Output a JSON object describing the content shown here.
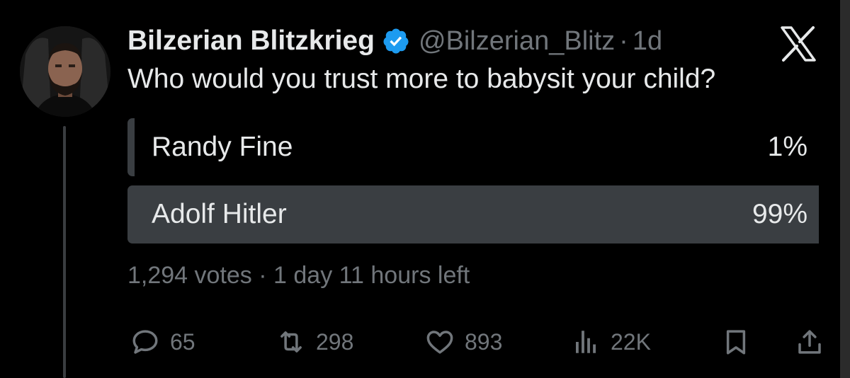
{
  "tweet": {
    "author_name": "Bilzerian Blitzkrieg",
    "handle": "@Bilzerian_Blitz",
    "separator": "·",
    "time_ago": "1d",
    "text": "Who would you trust more to babysit your child?"
  },
  "poll": {
    "options": [
      {
        "label": "Randy Fine",
        "percent": "1%",
        "share": 0.01
      },
      {
        "label": "Adolf Hitler",
        "percent": "99%",
        "share": 0.99
      }
    ],
    "votes": "1,294 votes",
    "separator": "·",
    "time_left": "1 day 11 hours left"
  },
  "actions": {
    "replies": "65",
    "reposts": "298",
    "likes": "893",
    "views": "22K"
  },
  "icons": {
    "verified": "verified-badge-icon",
    "logo": "x-logo-icon",
    "reply": "reply-icon",
    "repost": "repost-icon",
    "like": "heart-icon",
    "views": "views-icon",
    "bookmark": "bookmark-icon",
    "share": "share-icon"
  },
  "colors": {
    "background": "#000000",
    "text": "#e7e9ea",
    "secondary": "#71767b",
    "verified": "#1d9bf0",
    "poll_fill": "#3a3e42"
  }
}
